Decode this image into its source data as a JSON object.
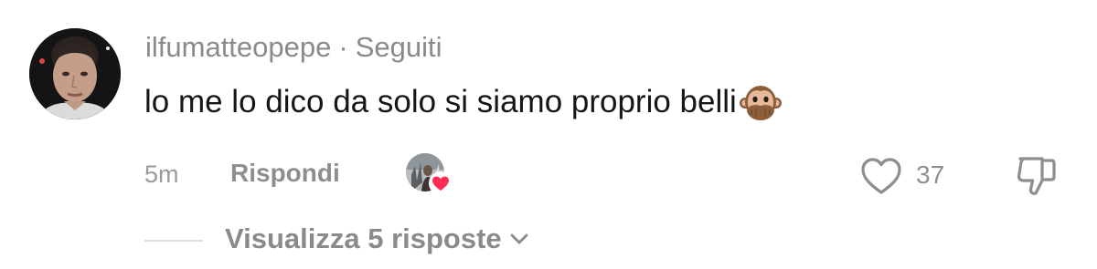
{
  "comment": {
    "username": "ilfumatteopepe",
    "separator": "·",
    "follow_status": "Seguiti",
    "text": "lo me lo dico da solo si siamo proprio belli",
    "emoji_icon": "speak-no-evil-monkey-icon"
  },
  "meta": {
    "time": "5m",
    "reply_label": "Rispondi",
    "like_count": "37"
  },
  "replies": {
    "label": "Visualizza 5 risposte"
  },
  "colors": {
    "username": "#8a8a8a",
    "text": "#161616",
    "muted": "#8e8e8e",
    "heart": "#fe2c55"
  }
}
